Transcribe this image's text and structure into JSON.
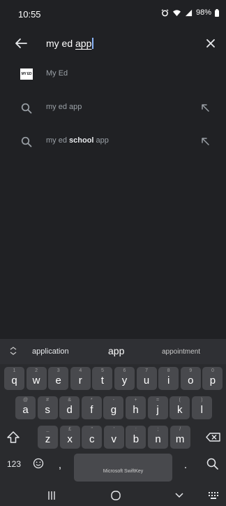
{
  "status_bar": {
    "time": "10:55",
    "battery": "98%"
  },
  "search": {
    "query_prefix": "my ed ",
    "query_underlined": "app"
  },
  "suggestions": [
    {
      "type": "app",
      "label": "My Ed",
      "thumb_text": "MY ED"
    },
    {
      "type": "query",
      "pre": "my ed app",
      "bold": "",
      "post": ""
    },
    {
      "type": "query",
      "pre": "my ed ",
      "bold": "school",
      "post": " app"
    }
  ],
  "keyboard": {
    "suggestion_strip": [
      "application",
      "app",
      "appointment"
    ],
    "row1": [
      {
        "k": "q",
        "a": "1"
      },
      {
        "k": "w",
        "a": "2"
      },
      {
        "k": "e",
        "a": "3"
      },
      {
        "k": "r",
        "a": "4"
      },
      {
        "k": "t",
        "a": "5"
      },
      {
        "k": "y",
        "a": "6"
      },
      {
        "k": "u",
        "a": "7"
      },
      {
        "k": "i",
        "a": "8"
      },
      {
        "k": "o",
        "a": "9"
      },
      {
        "k": "p",
        "a": "0"
      }
    ],
    "row2": [
      {
        "k": "a",
        "a": "@"
      },
      {
        "k": "s",
        "a": "#"
      },
      {
        "k": "d",
        "a": "&"
      },
      {
        "k": "f",
        "a": "*"
      },
      {
        "k": "g",
        "a": "-"
      },
      {
        "k": "h",
        "a": "+"
      },
      {
        "k": "j",
        "a": "="
      },
      {
        "k": "k",
        "a": "("
      },
      {
        "k": "l",
        "a": ")"
      }
    ],
    "row3": [
      {
        "k": "z",
        "a": "_"
      },
      {
        "k": "x",
        "a": "£"
      },
      {
        "k": "c",
        "a": "\""
      },
      {
        "k": "v",
        "a": "'"
      },
      {
        "k": "b",
        "a": ":"
      },
      {
        "k": "n",
        "a": ";"
      },
      {
        "k": "m",
        "a": "/"
      }
    ],
    "numbers_key": "123",
    "comma_key": ",",
    "period_key": ".",
    "space_label": "Microsoft SwiftKey"
  }
}
